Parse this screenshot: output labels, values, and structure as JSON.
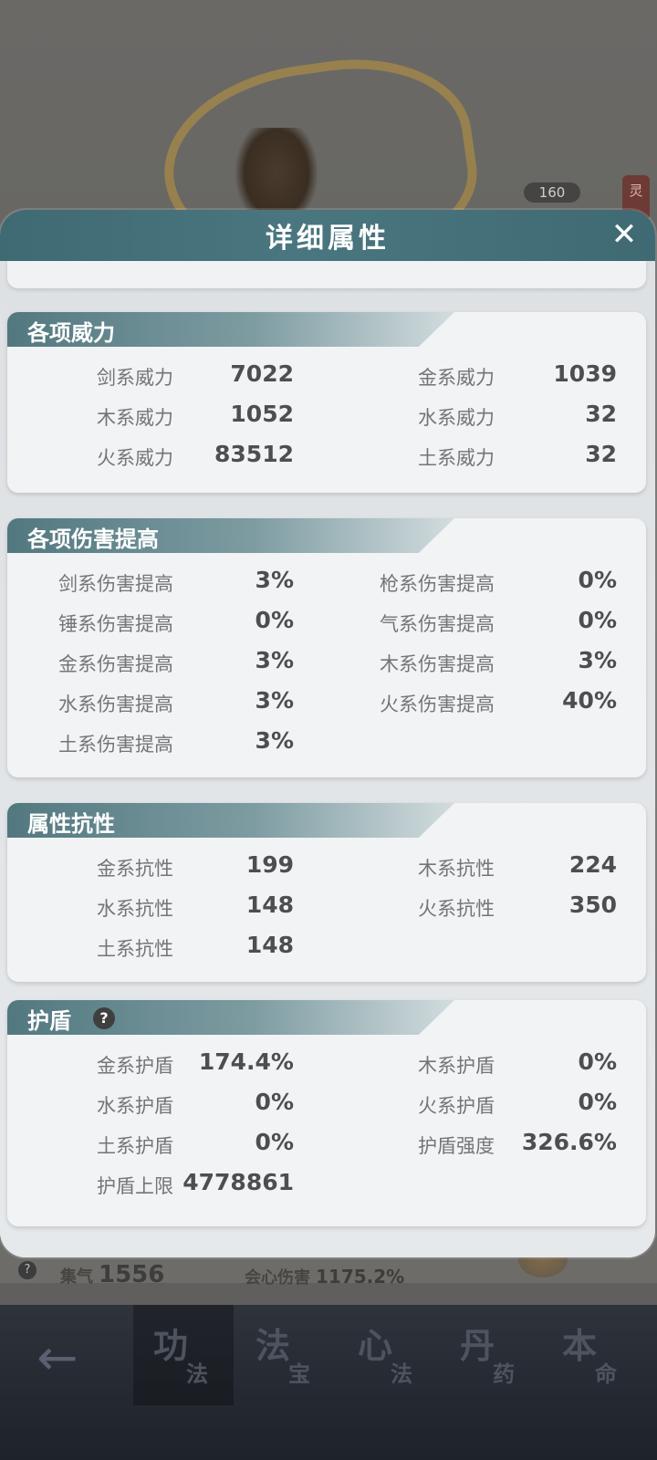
{
  "dialog": {
    "title": "详细属性",
    "close_symbol": "✕"
  },
  "background": {
    "level_badge": "160",
    "side_tag": "灵",
    "stats": [
      {
        "label": "集气",
        "value": "1556"
      },
      {
        "label": "会心伤害",
        "value": "1175.2%"
      }
    ],
    "help_symbol": "?"
  },
  "nav": {
    "back_symbol": "←",
    "tabs": [
      {
        "big": "功",
        "small": "法",
        "active": true
      },
      {
        "big": "法",
        "small": "宝",
        "active": false
      },
      {
        "big": "心",
        "small": "法",
        "active": false
      },
      {
        "big": "丹",
        "small": "药",
        "active": false
      },
      {
        "big": "本",
        "small": "命",
        "active": false
      }
    ]
  },
  "sections": {
    "power": {
      "title": "各项威力",
      "left": [
        {
          "label": "剑系威力",
          "value": "7022"
        },
        {
          "label": "木系威力",
          "value": "1052"
        },
        {
          "label": "火系威力",
          "value": "83512"
        }
      ],
      "right": [
        {
          "label": "金系威力",
          "value": "1039"
        },
        {
          "label": "水系威力",
          "value": "32"
        },
        {
          "label": "土系威力",
          "value": "32"
        }
      ]
    },
    "damage": {
      "title": "各项伤害提高",
      "left": [
        {
          "label": "剑系伤害提高",
          "value": "3%"
        },
        {
          "label": "锤系伤害提高",
          "value": "0%"
        },
        {
          "label": "金系伤害提高",
          "value": "3%"
        },
        {
          "label": "水系伤害提高",
          "value": "3%"
        },
        {
          "label": "土系伤害提高",
          "value": "3%"
        }
      ],
      "right": [
        {
          "label": "枪系伤害提高",
          "value": "0%"
        },
        {
          "label": "气系伤害提高",
          "value": "0%"
        },
        {
          "label": "木系伤害提高",
          "value": "3%"
        },
        {
          "label": "火系伤害提高",
          "value": "40%"
        }
      ]
    },
    "resist": {
      "title": "属性抗性",
      "left": [
        {
          "label": "金系抗性",
          "value": "199"
        },
        {
          "label": "水系抗性",
          "value": "148"
        },
        {
          "label": "土系抗性",
          "value": "148"
        }
      ],
      "right": [
        {
          "label": "木系抗性",
          "value": "224"
        },
        {
          "label": "火系抗性",
          "value": "350"
        }
      ]
    },
    "shield": {
      "title": "护盾",
      "help_symbol": "?",
      "left": [
        {
          "label": "金系护盾",
          "value": "174.4%"
        },
        {
          "label": "水系护盾",
          "value": "0%"
        },
        {
          "label": "土系护盾",
          "value": "0%"
        },
        {
          "label": "护盾上限",
          "value": "4778861"
        }
      ],
      "right": [
        {
          "label": "木系护盾",
          "value": "0%"
        },
        {
          "label": "火系护盾",
          "value": "0%"
        },
        {
          "label": "护盾强度",
          "value": "326.6%"
        }
      ]
    }
  }
}
